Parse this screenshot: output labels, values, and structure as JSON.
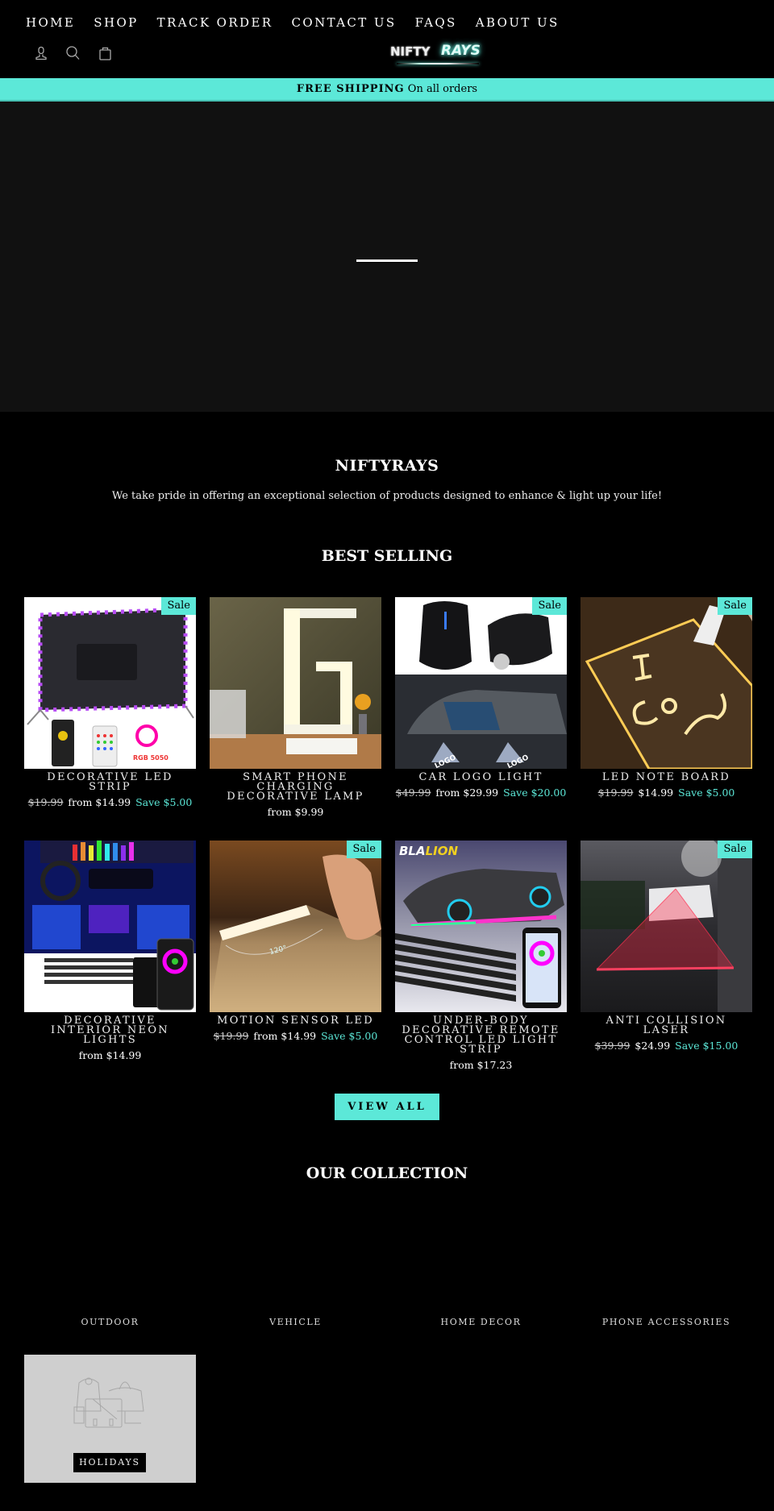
{
  "header": {
    "nav": [
      "HOME",
      "SHOP",
      "TRACK ORDER",
      "CONTACT US",
      "FAQS",
      "ABOUT US"
    ],
    "icons": [
      "account-icon",
      "search-icon",
      "cart-icon"
    ],
    "logo": {
      "part1": "NIFTY",
      "part2": "RAYS"
    }
  },
  "announcement": {
    "bold": "FREE SHIPPING",
    "text": "On all orders"
  },
  "intro": {
    "title": "NIFTYRAYS",
    "text": "We take pride in offering an exceptional selection of products designed to enhance & light up your life!"
  },
  "best_selling": {
    "title": "BEST SELLING",
    "products": [
      {
        "name": "DECORATIVE LED STRIP",
        "sale": "Sale",
        "was": "$19.99",
        "price": "from $14.99",
        "save": "Save $5.00"
      },
      {
        "name": "SMART PHONE CHARGING DECORATIVE LAMP",
        "sale": null,
        "was": null,
        "price": "from $9.99",
        "save": null
      },
      {
        "name": "CAR LOGO LIGHT",
        "sale": "Sale",
        "was": "$49.99",
        "price": "from $29.99",
        "save": "Save $20.00"
      },
      {
        "name": "LED NOTE BOARD",
        "sale": "Sale",
        "was": "$19.99",
        "price": "$14.99",
        "save": "Save $5.00"
      },
      {
        "name": "DECORATIVE INTERIOR NEON LIGHTS",
        "sale": null,
        "was": null,
        "price": "from $14.99",
        "save": null
      },
      {
        "name": "MOTION SENSOR LED",
        "sale": "Sale",
        "was": "$19.99",
        "price": "from $14.99",
        "save": "Save $5.00"
      },
      {
        "name": "UNDER-BODY DECORATIVE REMOTE CONTROL LED LIGHT STRIP",
        "sale": null,
        "was": null,
        "price": "from $17.23",
        "save": null
      },
      {
        "name": "ANTI COLLISION LASER",
        "sale": "Sale",
        "was": "$39.99",
        "price": "$24.99",
        "save": "Save $15.00"
      }
    ],
    "view_all": "VIEW ALL"
  },
  "collection": {
    "title": "OUR COLLECTION",
    "items": [
      "OUTDOOR",
      "VEHICLE",
      "HOME DECOR",
      "PHONE ACCESSORIES"
    ],
    "holiday": "HOLIDAYS"
  },
  "colors": {
    "accent": "#5ce8d8",
    "background": "#000000",
    "hero": "#111111"
  }
}
